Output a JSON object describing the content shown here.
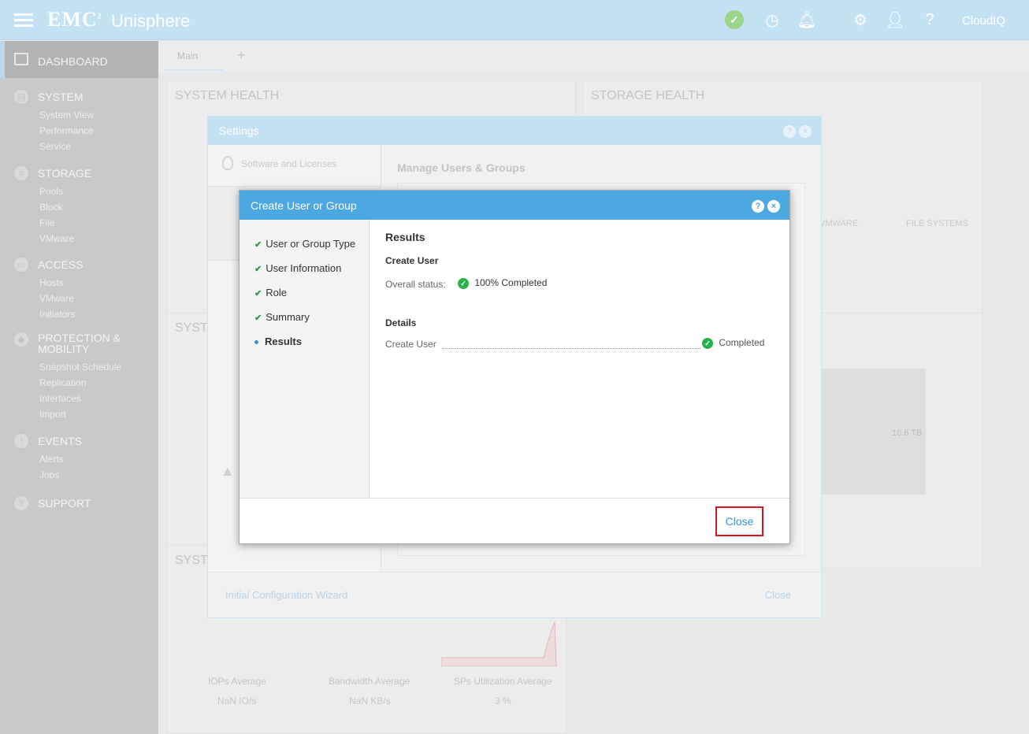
{
  "topbar": {
    "brand": "EMC",
    "brand_sup": "2",
    "product": "Unisphere",
    "cloudiq": "CloudIQ",
    "icons": [
      "menu-icon",
      "health-ok-icon",
      "jobs-icon",
      "alerts-bell-icon",
      "settings-gear-icon",
      "user-icon",
      "help-icon"
    ]
  },
  "sidebar": {
    "dashboard": "DASHBOARD",
    "system": {
      "label": "SYSTEM",
      "items": [
        "System View",
        "Performance",
        "Service"
      ]
    },
    "storage": {
      "label": "STORAGE",
      "items": [
        "Pools",
        "Block",
        "File",
        "VMware"
      ]
    },
    "access": {
      "label": "ACCESS",
      "items": [
        "Hosts",
        "VMware",
        "Initiators"
      ]
    },
    "protection": {
      "label_1": "PROTECTION &",
      "label_2": "MOBILITY",
      "items": [
        "Snapshot Schedule",
        "Replication",
        "Interfaces",
        "Import"
      ]
    },
    "events": {
      "label": "EVENTS",
      "items": [
        "Alerts",
        "Jobs"
      ]
    },
    "support": {
      "label": "SUPPORT"
    }
  },
  "main": {
    "tab_main": "Main",
    "tab_add": "+",
    "panel_system_health": "SYSTEM HEALTH",
    "panel_storage_health": "STORAGE HEALTH",
    "panel_syst_2": "SYST",
    "panel_syst_3": "SYST",
    "vmware_label": "VMWARE",
    "file_systems_label": "FILE SYSTEMS",
    "capacity_value": "10.6 TB",
    "metrics": {
      "iops_label": "IOPs Average",
      "iops_value": "NaN IO/s",
      "bandwidth_label": "Bandwidth Average",
      "bandwidth_value": "NaN KB/s",
      "sp_label": "SPs Utilization Average",
      "sp_value": "3 %"
    }
  },
  "settings_dialog": {
    "title": "Settings",
    "left_item": "Software and Licenses",
    "right_title": "Manage Users & Groups",
    "wizard_link": "Initial Configuration Wizard",
    "close": "Close"
  },
  "create_dialog": {
    "title": "Create User or Group",
    "steps": [
      {
        "label": "User or Group Type",
        "state": "done"
      },
      {
        "label": "User Information",
        "state": "done"
      },
      {
        "label": "Role",
        "state": "done"
      },
      {
        "label": "Summary",
        "state": "done"
      },
      {
        "label": "Results",
        "state": "current"
      }
    ],
    "results_title": "Results",
    "create_user_heading": "Create User",
    "overall_status_label": "Overall status:",
    "overall_status_value": "100% Completed",
    "details_heading": "Details",
    "detail_row_label": "Create User",
    "detail_row_status": "Completed",
    "close_button": "Close",
    "colors": {
      "header": "#4ca8e1",
      "success": "#2ab24e",
      "close_highlight": "#d0191e"
    }
  }
}
